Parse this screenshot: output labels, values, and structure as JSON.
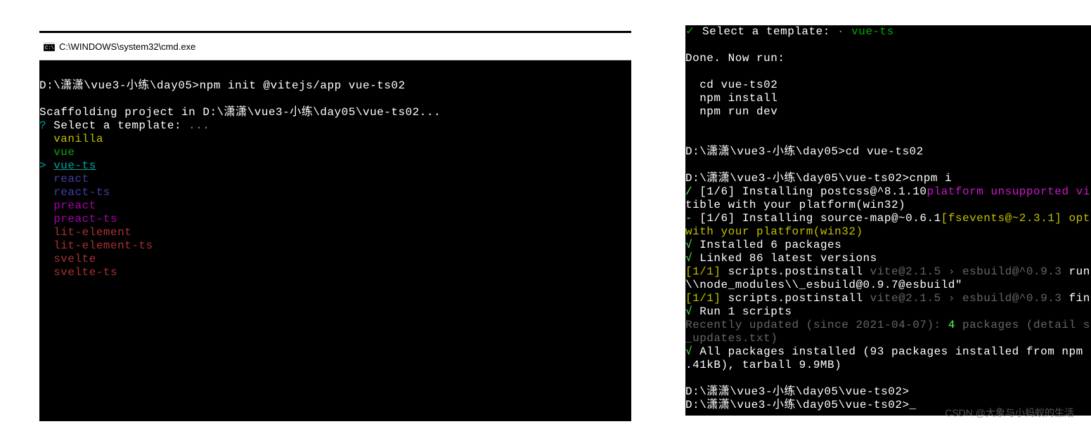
{
  "left": {
    "titlebar": {
      "title": "C:\\WINDOWS\\system32\\cmd.exe"
    },
    "prompt1_path": "D:\\潇潇\\vue3-小练\\day05>",
    "prompt1_cmd": "npm init @vitejs/app vue-ts02",
    "scaffold": "Scaffolding project in D:\\潇潇\\vue3-小练\\day05\\vue-ts02...",
    "q_mark": "?",
    "select_label": " Select a template: ",
    "ellipsis": "...",
    "opt_vanilla": "  vanilla",
    "opt_vue": "  vue",
    "sel_marker": "> ",
    "opt_vue_ts": "vue-ts",
    "opt_react": "  react",
    "opt_react_ts": "  react-ts",
    "opt_preact": "  preact",
    "opt_preact_ts": "  preact-ts",
    "opt_lit": "  lit-element",
    "opt_lit_ts": "  lit-element-ts",
    "opt_svelte": "  svelte",
    "opt_svelte_ts": "  svelte-ts"
  },
  "right": {
    "top_sel_a": "✓",
    "top_sel_b": " Select a template: ",
    "top_sel_c": "· ",
    "top_sel_d": "vue-ts",
    "done": "Done. Now run:",
    "cd": "  cd vue-ts02",
    "install": "  npm install",
    "rundev": "  npm run dev",
    "p2_path": "D:\\潇潇\\vue3-小练\\day05>",
    "p2_cmd": "cd vue-ts02",
    "p3_path": "D:\\潇潇\\vue3-小练\\day05\\vue-ts02>",
    "p3_cmd": "cnpm i",
    "l1a": "/",
    "l1b": " [1/6] Installing postcss@^8.1.10",
    "l1c": "platform unsupported vi",
    "l2": "tible with your platform(win32)",
    "l3a": "-",
    "l3b": " [1/6] Installing source-map@~0.6.1",
    "l3c": "[fsevents@~2.3.1] opt",
    "l4": "with your platform(win32)",
    "ck": "√",
    "ins6": " Installed 6 packages",
    "link86": " Linked 86 latest versions",
    "s1a": "[1/1]",
    "s1b": " scripts.postinstall ",
    "s1c": "vite@2.1.5 › esbuild@^0.9.3",
    "s1d": " run",
    "node": "\\\\node_modules\\\\_esbuild@0.9.7@esbuild\"",
    "s2a": "[1/1]",
    "s2b": " scripts.postinstall ",
    "s2c": "vite@2.1.5 › esbuild@^0.9.3",
    "s2d": " fin",
    "run1": " Run 1 scripts",
    "recA": "Recently updated (since 2021-04-07): ",
    "recB": "4",
    "recC": " packages",
    "recD": " (detail s",
    "recE": "_updates.txt)",
    "allpkg": " All packages installed (93 packages installed from npm",
    "tar": ".41kB), tarball 9.9MB)",
    "p4": "D:\\潇潇\\vue3-小练\\day05\\vue-ts02>",
    "p5": "D:\\潇潇\\vue3-小练\\day05\\vue-ts02>"
  },
  "watermark": "CSDN @大象与小蚂蚁的生活"
}
